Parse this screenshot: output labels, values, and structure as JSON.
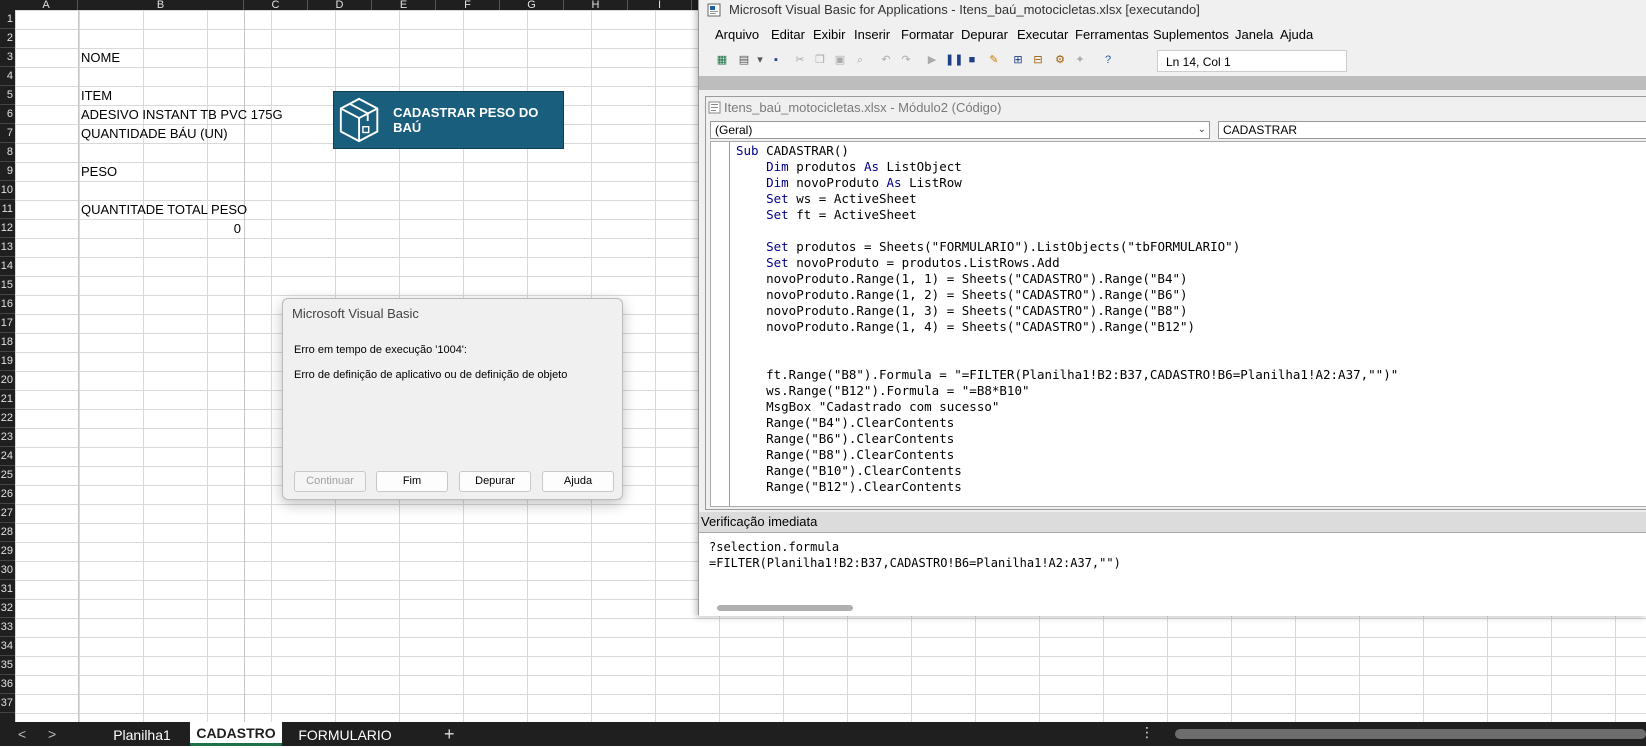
{
  "excel": {
    "columns": [
      "A",
      "B",
      "C",
      "D",
      "E",
      "F",
      "G",
      "H",
      "I"
    ],
    "rows": [
      "1",
      "2",
      "3",
      "4",
      "5",
      "6",
      "7",
      "8",
      "9",
      "10",
      "11",
      "12",
      "13",
      "14",
      "15",
      "16",
      "17",
      "18",
      "19",
      "20",
      "21",
      "22",
      "23",
      "24",
      "25",
      "26",
      "27",
      "28",
      "29",
      "30",
      "31",
      "32",
      "33",
      "34",
      "35",
      "36",
      "37"
    ],
    "cells": {
      "b3": "NOME",
      "b5": "ITEM",
      "b6": "ADESIVO INSTANT TB PVC 175G",
      "b7": "QUANTIDADE BÁU (UN)",
      "b9": "PESO",
      "b11": "QUANTITADE TOTAL PESO",
      "b12": "0"
    },
    "shape_button": {
      "label": "CADASTRAR PESO DO BAÚ",
      "icon": "box-icon"
    },
    "sheet_tabs": [
      "Planilha1",
      "CADASTRO",
      "FORMULARIO"
    ],
    "active_tab": "CADASTRO",
    "add_tab": "+",
    "nav_prev": "<",
    "nav_next": ">",
    "more": "⋮"
  },
  "vbe": {
    "title": "Microsoft Visual Basic for Applications - Itens_baú_motocicletas.xlsx [executando]",
    "menu": [
      "Arquivo",
      "Editar",
      "Exibir",
      "Inserir",
      "Formatar",
      "Depurar",
      "Executar",
      "Ferramentas",
      "Suplementos",
      "Janela",
      "Ajuda"
    ],
    "position": "Ln 14, Col 1",
    "code_window": {
      "title": "Itens_baú_motocicletas.xlsx - Módulo2 (Código)",
      "object_dropdown": "(Geral)",
      "proc_dropdown": "CADASTRAR",
      "lines": [
        "Sub CADASTRAR()",
        "    Dim produtos As ListObject",
        "    Dim novoProduto As ListRow",
        "    Set ws = ActiveSheet",
        "    Set ft = ActiveSheet",
        "",
        "    Set produtos = Sheets(\"FORMULARIO\").ListObjects(\"tbFORMULARIO\")",
        "    Set novoProduto = produtos.ListRows.Add",
        "    novoProduto.Range(1, 1) = Sheets(\"CADASTRO\").Range(\"B4\")",
        "    novoProduto.Range(1, 2) = Sheets(\"CADASTRO\").Range(\"B6\")",
        "    novoProduto.Range(1, 3) = Sheets(\"CADASTRO\").Range(\"B8\")",
        "    novoProduto.Range(1, 4) = Sheets(\"CADASTRO\").Range(\"B12\")",
        "",
        "",
        "    ft.Range(\"B8\").Formula = \"=FILTER(Planilha1!B2:B37,CADASTRO!B6=Planilha1!A2:A37,\"\")\"",
        "    ws.Range(\"B12\").Formula = \"=B8*B10\"",
        "    MsgBox \"Cadastrado com sucesso\"",
        "    Range(\"B4\").ClearContents",
        "    Range(\"B6\").ClearContents",
        "    Range(\"B8\").ClearContents",
        "    Range(\"B10\").ClearContents",
        "    Range(\"B12\").ClearContents"
      ]
    },
    "immediate": {
      "title": "Verificação imediata",
      "lines": [
        "?selection.formula",
        "=FILTER(Planilha1!B2:B37,CADASTRO!B6=Planilha1!A2:A37,\"\")"
      ]
    }
  },
  "msgbox": {
    "title": "Microsoft Visual Basic",
    "line1": "Erro em tempo de execução '1004':",
    "line2": "Erro de definição de aplicativo ou de definição de objeto",
    "buttons": {
      "continue": "Continuar",
      "end": "Fim",
      "debug": "Depurar",
      "help": "Ajuda"
    }
  },
  "colors": {
    "accent": "#1a5e7e",
    "keyword": "#00008b",
    "active_tab_underline": "#1e7145"
  }
}
